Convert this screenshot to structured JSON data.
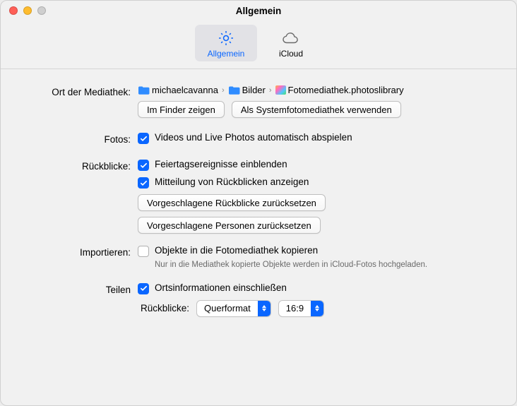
{
  "window": {
    "title": "Allgemein"
  },
  "tabs": {
    "general": "Allgemein",
    "icloud": "iCloud"
  },
  "labels": {
    "libraryLocation": "Ort der Mediathek:",
    "photos": "Fotos:",
    "memories": "Rückblicke:",
    "import": "Importieren:",
    "share": "Teilen",
    "memoriesSub": "Rückblicke:"
  },
  "breadcrumb": {
    "seg1": "michaelcavanna",
    "seg2": "Bilder",
    "seg3": "Fotomediathek.photoslibrary"
  },
  "buttons": {
    "showInFinder": "Im Finder zeigen",
    "useAsSystem": "Als Systemfotomediathek verwenden",
    "resetMemories": "Vorgeschlagene Rückblicke zurücksetzen",
    "resetPeople": "Vorgeschlagene Personen zurücksetzen"
  },
  "checks": {
    "autoplay": "Videos und Live Photos automatisch abspielen",
    "holidays": "Feiertagsereignisse einblenden",
    "notify": "Mitteilung von Rückblicken anzeigen",
    "copyItems": "Objekte in die Fotomediathek kopieren",
    "copyHint": "Nur in die Mediathek kopierte Objekte werden in iCloud-Fotos hochgeladen.",
    "location": "Ortsinformationen einschließen"
  },
  "selects": {
    "orientation": "Querformat",
    "ratio": "16:9"
  }
}
